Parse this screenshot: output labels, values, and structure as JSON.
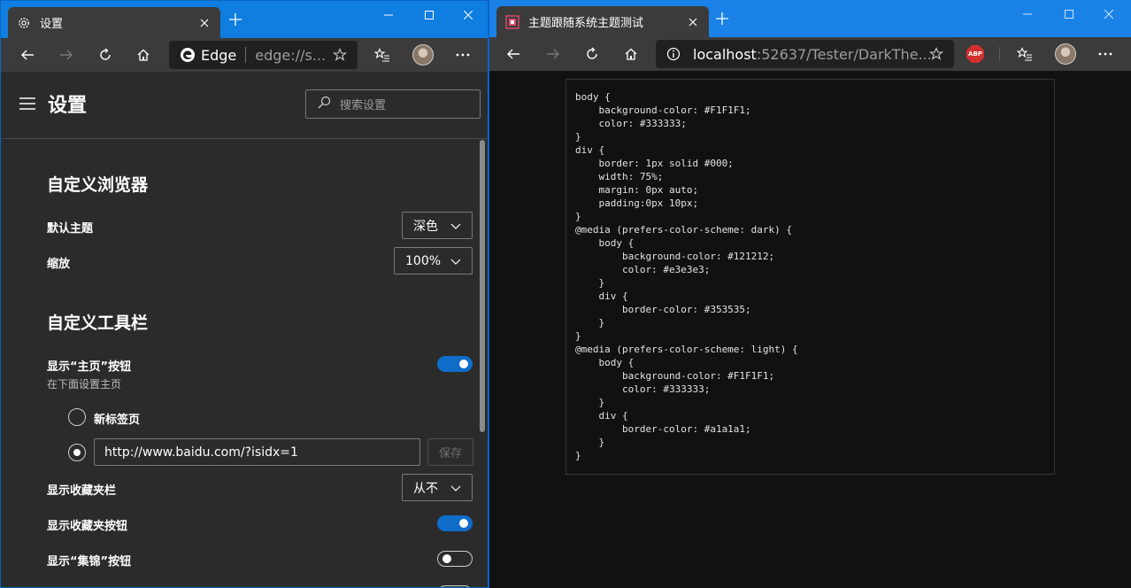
{
  "left_window": {
    "tab_title": "设置",
    "address": {
      "brand": "Edge",
      "url": "edge://s..."
    },
    "settings": {
      "title": "设置",
      "search_placeholder": "搜索设置",
      "sections": {
        "browser": {
          "title": "自定义浏览器",
          "theme_label": "默认主题",
          "theme_value": "深色",
          "zoom_label": "缩放",
          "zoom_value": "100%"
        },
        "toolbar": {
          "title": "自定义工具栏",
          "home_label": "显示“主页”按钮",
          "home_sub": "在下面设置主页",
          "home_enabled": true,
          "radio_newtab": "新标签页",
          "home_url": "http://www.baidu.com/?isidx=1",
          "save_label": "保存",
          "favbar_label": "显示收藏夹栏",
          "favbar_value": "从不",
          "favbtn_label": "显示收藏夹按钮",
          "favbtn_enabled": true,
          "collections_label": "显示“集锦”按钮",
          "collections_enabled": false
        }
      }
    }
  },
  "right_window": {
    "tab_title": "主题跟随系统主题测试",
    "address": {
      "host": "localhost",
      "rest": ":52637/Tester/DarkThe..."
    },
    "abp_label": "ABP",
    "code": "body {\n    background-color: #F1F1F1;\n    color: #333333;\n}\ndiv {\n    border: 1px solid #000;\n    width: 75%;\n    margin: 0px auto;\n    padding:0px 10px;\n}\n@media (prefers-color-scheme: dark) {\n    body {\n        background-color: #121212;\n        color: #e3e3e3;\n    }\n    div {\n        border-color: #353535;\n    }\n}\n@media (prefers-color-scheme: light) {\n    body {\n        background-color: #F1F1F1;\n        color: #333333;\n    }\n    div {\n        border-color: #a1a1a1;\n    }\n}"
  },
  "colors": {
    "titlebar_blue": "#0f7ee0",
    "accent_toggle": "#0f6cc9",
    "settings_bg": "#2b2b2b",
    "page_dark_bg": "#111111",
    "abp_red": "#d32f2f"
  }
}
